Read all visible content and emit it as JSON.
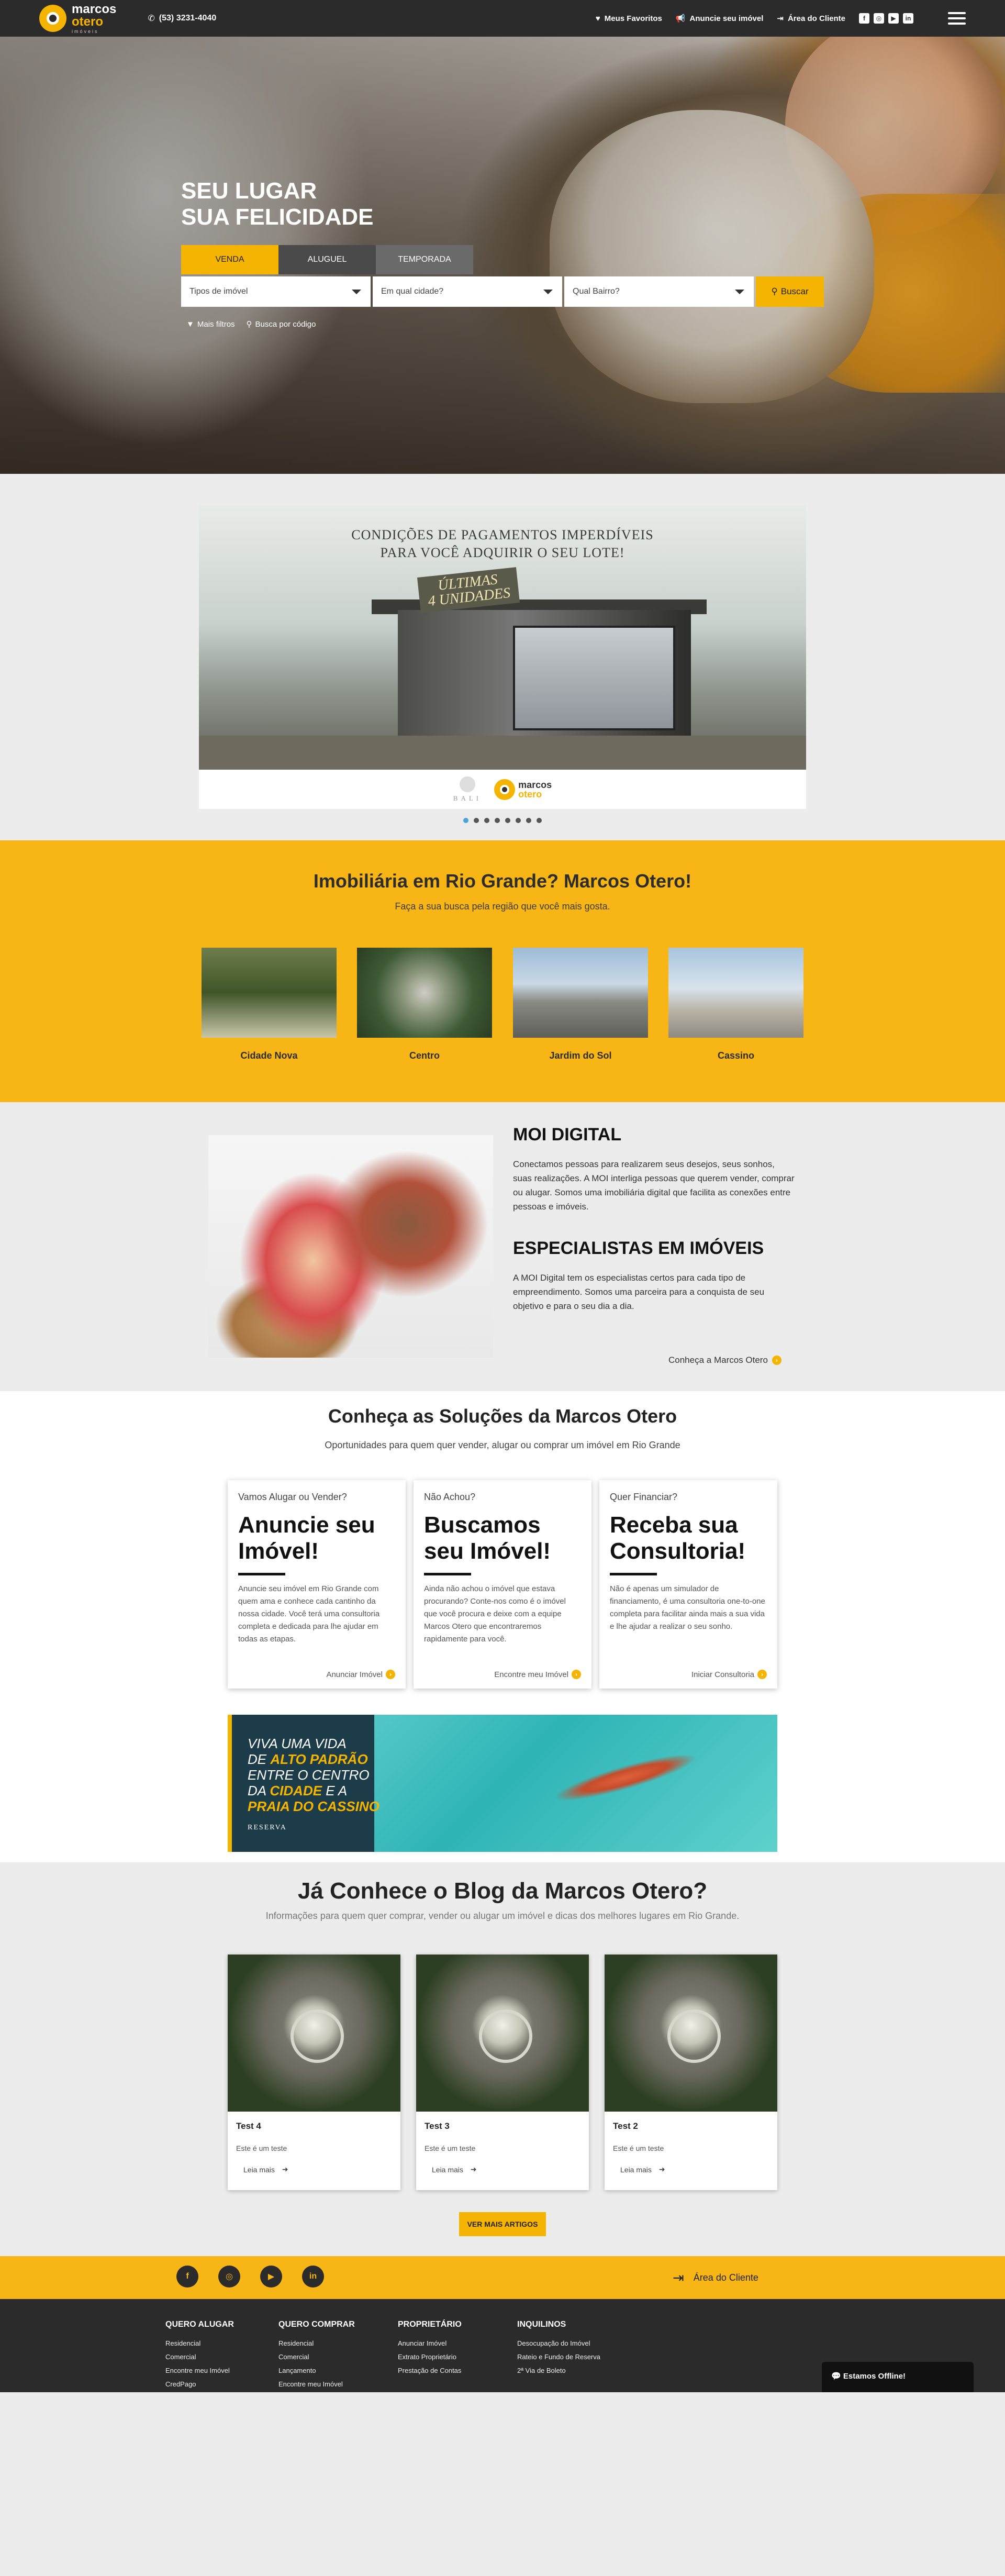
{
  "topbar": {
    "logo_top": "marcos",
    "logo_bottom": "otero",
    "logo_sub": "imóveis",
    "phone": "(53) 3231-4040",
    "favorites": "Meus Favoritos",
    "advertise": "Anuncie seu imóvel",
    "client_area": "Área do Cliente",
    "social_icons": [
      "facebook-icon",
      "instagram-icon",
      "youtube-icon",
      "linkedin-icon"
    ]
  },
  "hero": {
    "title_line1": "SEU LUGAR",
    "title_line2": "SUA FELICIDADE",
    "tabs": [
      {
        "label": "VENDA",
        "active": true
      },
      {
        "label": "ALUGUEL",
        "active": false
      },
      {
        "label": "TEMPORADA",
        "active": false
      }
    ],
    "selects": [
      "Tipos de imóvel",
      "Em qual cidade?",
      "Qual Bairro?"
    ],
    "search_button": "Buscar",
    "more_filters": "Mais filtros",
    "code_search": "Busca por código"
  },
  "banner": {
    "headline_line1": "CONDIÇÕES DE PAGAMENTOS IMPERDÍVEIS",
    "headline_line2": "PARA VOCÊ ADQUIRIR O SEU LOTE!",
    "badge_line1": "ÚLTIMAS",
    "badge_line2": "4 UNIDADES",
    "partner": "BALI",
    "logo_top": "marcos",
    "logo_bottom": "otero",
    "slides_total": 8,
    "active_slide": 1
  },
  "neighborhoods": {
    "title": "Imobiliária em Rio Grande? Marcos Otero!",
    "subtitle": "Faça a sua busca pela região que você mais gosta.",
    "items": [
      {
        "label": "Cidade Nova",
        "colors": [
          "#5e6d3c",
          "#c8c6a8"
        ]
      },
      {
        "label": "Centro",
        "colors": [
          "#3e5a34",
          "#8f9980"
        ]
      },
      {
        "label": "Jardim do Sol",
        "colors": [
          "#9dbcd6",
          "#7a7a78"
        ]
      },
      {
        "label": "Cassino",
        "colors": [
          "#a8c4de",
          "#cfcac0"
        ]
      }
    ]
  },
  "moi": {
    "heading1": "MOI DIGITAL",
    "text1": "Conectamos pessoas para realizarem seus desejos, seus sonhos, suas realizações. A MOI interliga pessoas que querem vender, comprar ou alugar. Somos uma imobiliária digital que facilita as conexões entre pessoas e imóveis.",
    "heading2": "ESPECIALISTAS EM IMÓVEIS",
    "text2": "A MOI Digital tem os especialistas certos para cada tipo de empreendimento. Somos uma parceira para a conquista de seu objetivo e para o seu dia a dia.",
    "link": "Conheça a Marcos Otero"
  },
  "solutions": {
    "title": "Conheça as Soluções da Marcos Otero",
    "subtitle": "Oportunidades para quem quer vender, alugar ou comprar um imóvel em Rio Grande",
    "cards": [
      {
        "question": "Vamos Alugar ou Vender?",
        "big": "Anuncie seu Imóvel!",
        "text": "Anuncie seu imóvel em Rio Grande com quem ama e conhece cada cantinho da nossa cidade. Você terá uma consultoria completa e dedicada para lhe ajudar em todas as etapas.",
        "link": "Anunciar Imóvel"
      },
      {
        "question": "Não Achou?",
        "big": "Buscamos seu Imóvel!",
        "text": "Ainda não achou o imóvel que estava procurando? Conte-nos como é o imóvel que você procura e deixe com a equipe Marcos Otero que encontraremos rapidamente para você.",
        "link": "Encontre meu Imóvel"
      },
      {
        "question": "Quer Financiar?",
        "big": "Receba sua Consultoria!",
        "text": "Não é apenas um simulador de financiamento, é uma consultoria one-to-one completa para facilitar ainda mais a sua vida e lhe ajudar a realizar o seu sonho.",
        "link": "Iniciar Consultoria"
      }
    ],
    "ad": {
      "line1": "VIVA UMA VIDA",
      "line2a": "DE ",
      "line2b": "ALTO PADRÃO",
      "line3": "ENTRE O CENTRO",
      "line4a": "DA ",
      "line4b": "CIDADE",
      "line4c": " E A",
      "line5": "PRAIA DO CASSINO",
      "brand": "RESERVA"
    }
  },
  "blog": {
    "title": "Já Conhece o Blog da Marcos Otero?",
    "subtitle": "Informações para quem quer comprar, vender ou alugar um imóvel e dicas dos melhores lugares em Rio Grande.",
    "posts": [
      {
        "title": "Test 4",
        "text": "Este é um teste",
        "more": "Leia mais"
      },
      {
        "title": "Test 3",
        "text": "Este é um teste",
        "more": "Leia mais"
      },
      {
        "title": "Test 2",
        "text": "Este é um teste",
        "more": "Leia mais"
      }
    ],
    "button": "VER MAIS ARTIGOS"
  },
  "footer": {
    "social": [
      {
        "icon": "facebook-icon",
        "glyph": "f"
      },
      {
        "icon": "instagram-icon",
        "glyph": "◎"
      },
      {
        "icon": "youtube-icon",
        "glyph": "▶"
      },
      {
        "icon": "linkedin-icon",
        "glyph": "in"
      }
    ],
    "client_area": "Área do Cliente",
    "columns": [
      {
        "title": "QUERO ALUGAR",
        "items": [
          "Residencial",
          "Comercial",
          "Encontre meu Imóvel",
          "CredPago"
        ]
      },
      {
        "title": "QUERO COMPRAR",
        "items": [
          "Residencial",
          "Comercial",
          "Lançamento",
          "Encontre meu Imóvel"
        ]
      },
      {
        "title": "PROPRIETÁRIO",
        "items": [
          "Anunciar Imóvel",
          "Extrato Proprietário",
          "Prestação de Contas"
        ]
      },
      {
        "title": "INQUILINOS",
        "items": [
          "Desocupação do Imóvel",
          "Rateio e Fundo de Reserva",
          "2ª Via de Boleto"
        ]
      }
    ],
    "chat": "Estamos Offline!"
  },
  "colors": {
    "accent": "#f8b616",
    "dark": "#2b2b2b"
  }
}
